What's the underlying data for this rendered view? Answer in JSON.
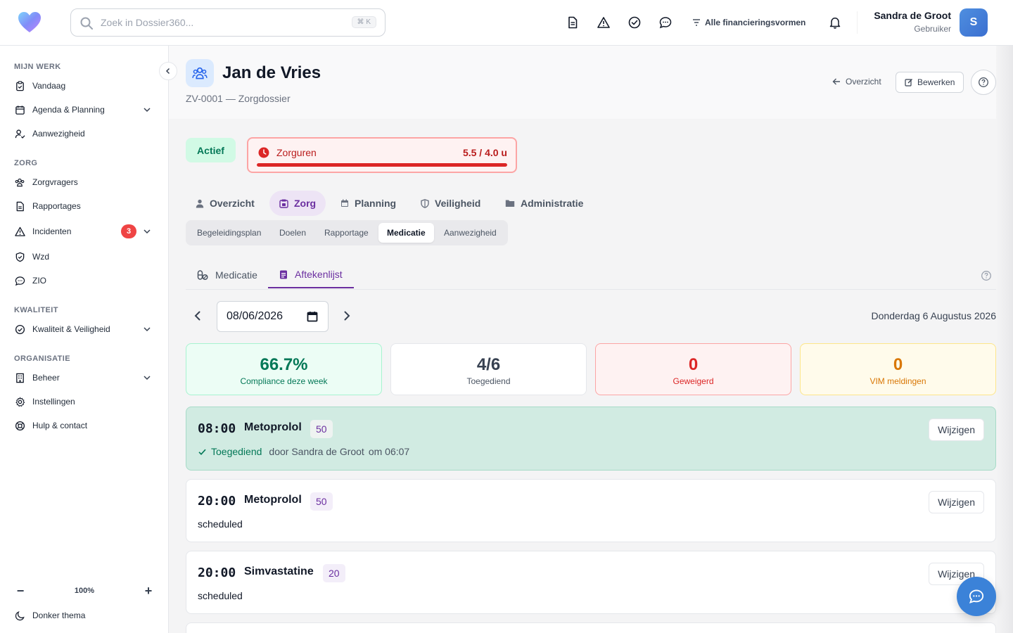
{
  "search": {
    "placeholder": "Zoek in Dossier360...",
    "shortcut": "⌘ K"
  },
  "topbar": {
    "icons": [
      "document-icon",
      "warning-icon",
      "check-circle-icon",
      "chat-icon",
      "bell-icon"
    ],
    "finance_filter": "Alle financieringsvormen"
  },
  "user": {
    "name": "Sandra de Groot",
    "role": "Gebruiker",
    "initial": "S"
  },
  "sidebar": {
    "sections": [
      {
        "title": "MIJN WERK"
      },
      {
        "title": "ZORG"
      },
      {
        "title": "KWALITEIT"
      },
      {
        "title": "ORGANISATIE"
      }
    ],
    "items": [
      {
        "label": "Vandaag",
        "icon": "clipboard-icon"
      },
      {
        "label": "Agenda & Planning",
        "icon": "calendar-icon"
      },
      {
        "label": "Aanwezigheid",
        "icon": "user-check-icon"
      },
      {
        "label": "Zorgvragers",
        "icon": "users-icon"
      },
      {
        "label": "Rapportages",
        "icon": "file-icon"
      },
      {
        "label": "Incidenten",
        "icon": "warning-icon",
        "badge": "3"
      },
      {
        "label": "Wzd",
        "icon": "shield-icon"
      },
      {
        "label": "ZIO",
        "icon": "chat-icon"
      },
      {
        "label": "Kwaliteit & Veiligheid",
        "icon": "check-circle-icon"
      },
      {
        "label": "Beheer",
        "icon": "building-icon"
      },
      {
        "label": "Instellingen",
        "icon": "gear-icon"
      },
      {
        "label": "Hulp & contact",
        "icon": "lifebuoy-icon"
      }
    ],
    "zoom": "100%",
    "theme_label": "Donker thema"
  },
  "header": {
    "client_name": "Jan de Vries",
    "subtitle": "ZV-0001 — Zorgdossier",
    "back_label": "Overzicht",
    "edit_label": "Bewerken"
  },
  "status": {
    "label": "Actief",
    "care_hours_label": "Zorguren",
    "care_hours_value": "5.5 / 4.0 u",
    "care_hours_fraction": 1.0,
    "alert_color": "#dc2626"
  },
  "tabs": {
    "main": [
      "Overzicht",
      "Zorg",
      "Planning",
      "Veiligheid",
      "Administratie"
    ],
    "sub": [
      "Begeleidingsplan",
      "Doelen",
      "Rapportage",
      "Medicatie",
      "Aanwezigheid"
    ],
    "inner": [
      "Medicatie",
      "Aftekenlijst"
    ]
  },
  "date": {
    "value": "08/06/2026",
    "long": "Donderdag 6 Augustus 2026"
  },
  "stats": [
    {
      "value": "66.7%",
      "label": "Compliance deze week"
    },
    {
      "value": "4/6",
      "label": "Toegediend"
    },
    {
      "value": "0",
      "label": "Geweigerd"
    },
    {
      "value": "0",
      "label": "VIM meldingen"
    }
  ],
  "medications": [
    {
      "time": "08:00",
      "name": "Metoprolol",
      "dose": "50",
      "status": "Toegediend",
      "by": "door Sandra de Groot",
      "at": "om 06:07",
      "action": "Wijzigen"
    },
    {
      "time": "20:00",
      "name": "Metoprolol",
      "dose": "50",
      "status": "scheduled",
      "action": "Wijzigen"
    },
    {
      "time": "20:00",
      "name": "Simvastatine",
      "dose": "20",
      "status": "scheduled",
      "action": "Wijzigen"
    }
  ],
  "colors": {
    "brand_purple": "#6b2fa0",
    "success": "#047857",
    "danger": "#dc2626",
    "warning": "#d97706"
  }
}
